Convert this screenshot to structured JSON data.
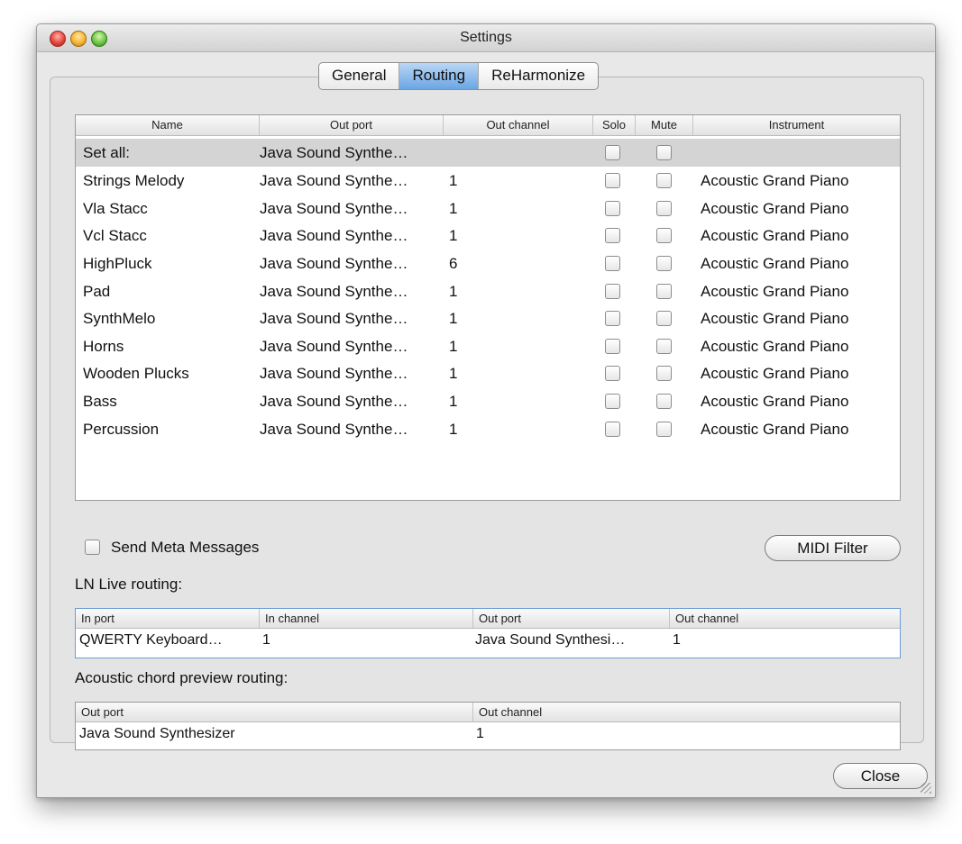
{
  "window": {
    "title": "Settings"
  },
  "tabs": [
    {
      "label": "General",
      "active": false
    },
    {
      "label": "Routing",
      "active": true
    },
    {
      "label": "ReHarmonize",
      "active": false
    }
  ],
  "tracks_table": {
    "columns": [
      "Name",
      "Out port",
      "Out channel",
      "Solo",
      "Mute",
      "Instrument"
    ],
    "set_all": {
      "name": "Set all:",
      "out_port": "Java Sound Synthe…",
      "out_channel": "",
      "instrument": ""
    },
    "rows": [
      {
        "name": "Strings Melody",
        "out_port": "Java Sound Synthe…",
        "out_channel": "1",
        "instrument": "Acoustic Grand Piano"
      },
      {
        "name": "Vla Stacc",
        "out_port": "Java Sound Synthe…",
        "out_channel": "1",
        "instrument": "Acoustic Grand Piano"
      },
      {
        "name": "Vcl Stacc",
        "out_port": "Java Sound Synthe…",
        "out_channel": "1",
        "instrument": "Acoustic Grand Piano"
      },
      {
        "name": "HighPluck",
        "out_port": "Java Sound Synthe…",
        "out_channel": "6",
        "instrument": "Acoustic Grand Piano"
      },
      {
        "name": "Pad",
        "out_port": "Java Sound Synthe…",
        "out_channel": "1",
        "instrument": "Acoustic Grand Piano"
      },
      {
        "name": "SynthMelo",
        "out_port": "Java Sound Synthe…",
        "out_channel": "1",
        "instrument": "Acoustic Grand Piano"
      },
      {
        "name": "Horns",
        "out_port": "Java Sound Synthe…",
        "out_channel": "1",
        "instrument": "Acoustic Grand Piano"
      },
      {
        "name": "Wooden Plucks",
        "out_port": "Java Sound Synthe…",
        "out_channel": "1",
        "instrument": "Acoustic Grand Piano"
      },
      {
        "name": "Bass",
        "out_port": "Java Sound Synthe…",
        "out_channel": "1",
        "instrument": "Acoustic Grand Piano"
      },
      {
        "name": "Percussion",
        "out_port": "Java Sound Synthe…",
        "out_channel": "1",
        "instrument": "Acoustic Grand Piano"
      }
    ]
  },
  "send_meta": {
    "label": "Send Meta Messages",
    "checked": false
  },
  "midi_filter_button": "MIDI Filter",
  "ln_live": {
    "label": "LN Live routing:",
    "columns": [
      "In port",
      "In channel",
      "Out port",
      "Out channel"
    ],
    "row": [
      "QWERTY Keyboard…",
      "1",
      "Java Sound Synthesi…",
      "1"
    ]
  },
  "chord_preview": {
    "label": "Acoustic chord preview routing:",
    "columns": [
      "Out port",
      "Out channel"
    ],
    "row": [
      "Java Sound Synthesizer",
      "1"
    ]
  },
  "close_button": "Close",
  "colors": {
    "tab_active": "#6aa6e4",
    "setall_row": "#d4d4d4"
  }
}
